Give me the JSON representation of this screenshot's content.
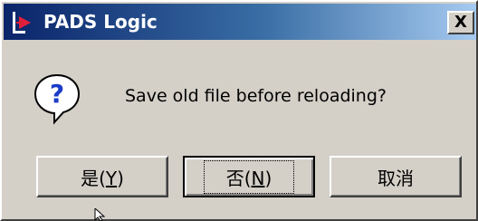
{
  "window": {
    "title": "PADS Logic",
    "close_glyph": "X"
  },
  "dialog": {
    "message": "Save old file before reloading?",
    "icon": "question-icon"
  },
  "buttons": {
    "yes": {
      "prefix": "是(",
      "mnemonic": "Y",
      "suffix": ")"
    },
    "no": {
      "prefix": "否(",
      "mnemonic": "N",
      "suffix": ")"
    },
    "cancel": {
      "label": "取消"
    }
  },
  "colors": {
    "titlebar_start": "#0a246a",
    "titlebar_end": "#a6caf0",
    "face": "#d4d0c8"
  }
}
